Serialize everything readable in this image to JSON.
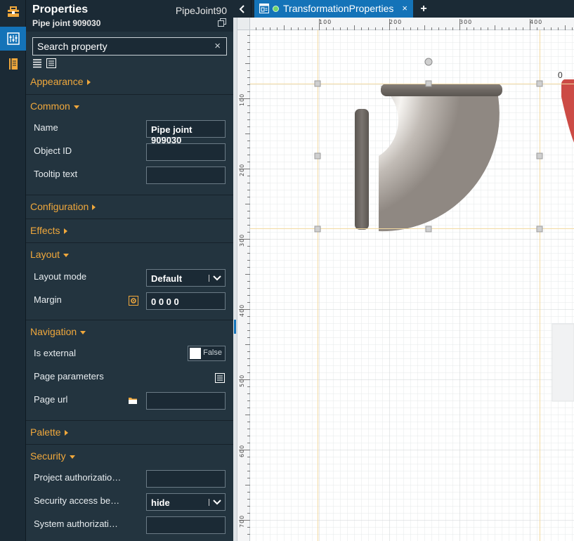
{
  "panel": {
    "title": "Properties",
    "subtitle": "Pipe joint 909030",
    "object_type": "PipeJoint90",
    "search_placeholder": "Search property",
    "search_clear": "×"
  },
  "sections": {
    "appearance": "Appearance",
    "common": "Common",
    "configuration": "Configuration",
    "effects": "Effects",
    "layout": "Layout",
    "navigation": "Navigation",
    "palette": "Palette",
    "security": "Security"
  },
  "common": {
    "name_label": "Name",
    "name_value": "Pipe joint 909030",
    "object_id_label": "Object ID",
    "object_id_value": "",
    "tooltip_label": "Tooltip text",
    "tooltip_value": ""
  },
  "layout": {
    "mode_label": "Layout mode",
    "mode_value": "Default",
    "margin_label": "Margin",
    "margin_value": "0 0 0 0"
  },
  "navigation": {
    "external_label": "Is external",
    "external_value": "False",
    "page_params_label": "Page parameters",
    "page_url_label": "Page url",
    "page_url_value": ""
  },
  "security": {
    "project_auth_label": "Project authorizatio…",
    "project_auth_value": "",
    "access_label": "Security access be…",
    "access_value": "hide",
    "system_auth_label": "System authorizati…",
    "system_auth_value": ""
  },
  "tabs": {
    "active_label": "TransformationProperties",
    "close": "×",
    "add": "+"
  },
  "canvas": {
    "ruler_top": [
      "100",
      "200",
      "300",
      "400"
    ],
    "ruler_left": [
      "100",
      "200",
      "300",
      "400",
      "500",
      "600",
      "700"
    ],
    "corner_label": "0"
  },
  "colors": {
    "accent": "#1473b8",
    "section_header": "#f0a83c",
    "panel_bg": "#23343f",
    "status_dot": "#6fd36a"
  }
}
